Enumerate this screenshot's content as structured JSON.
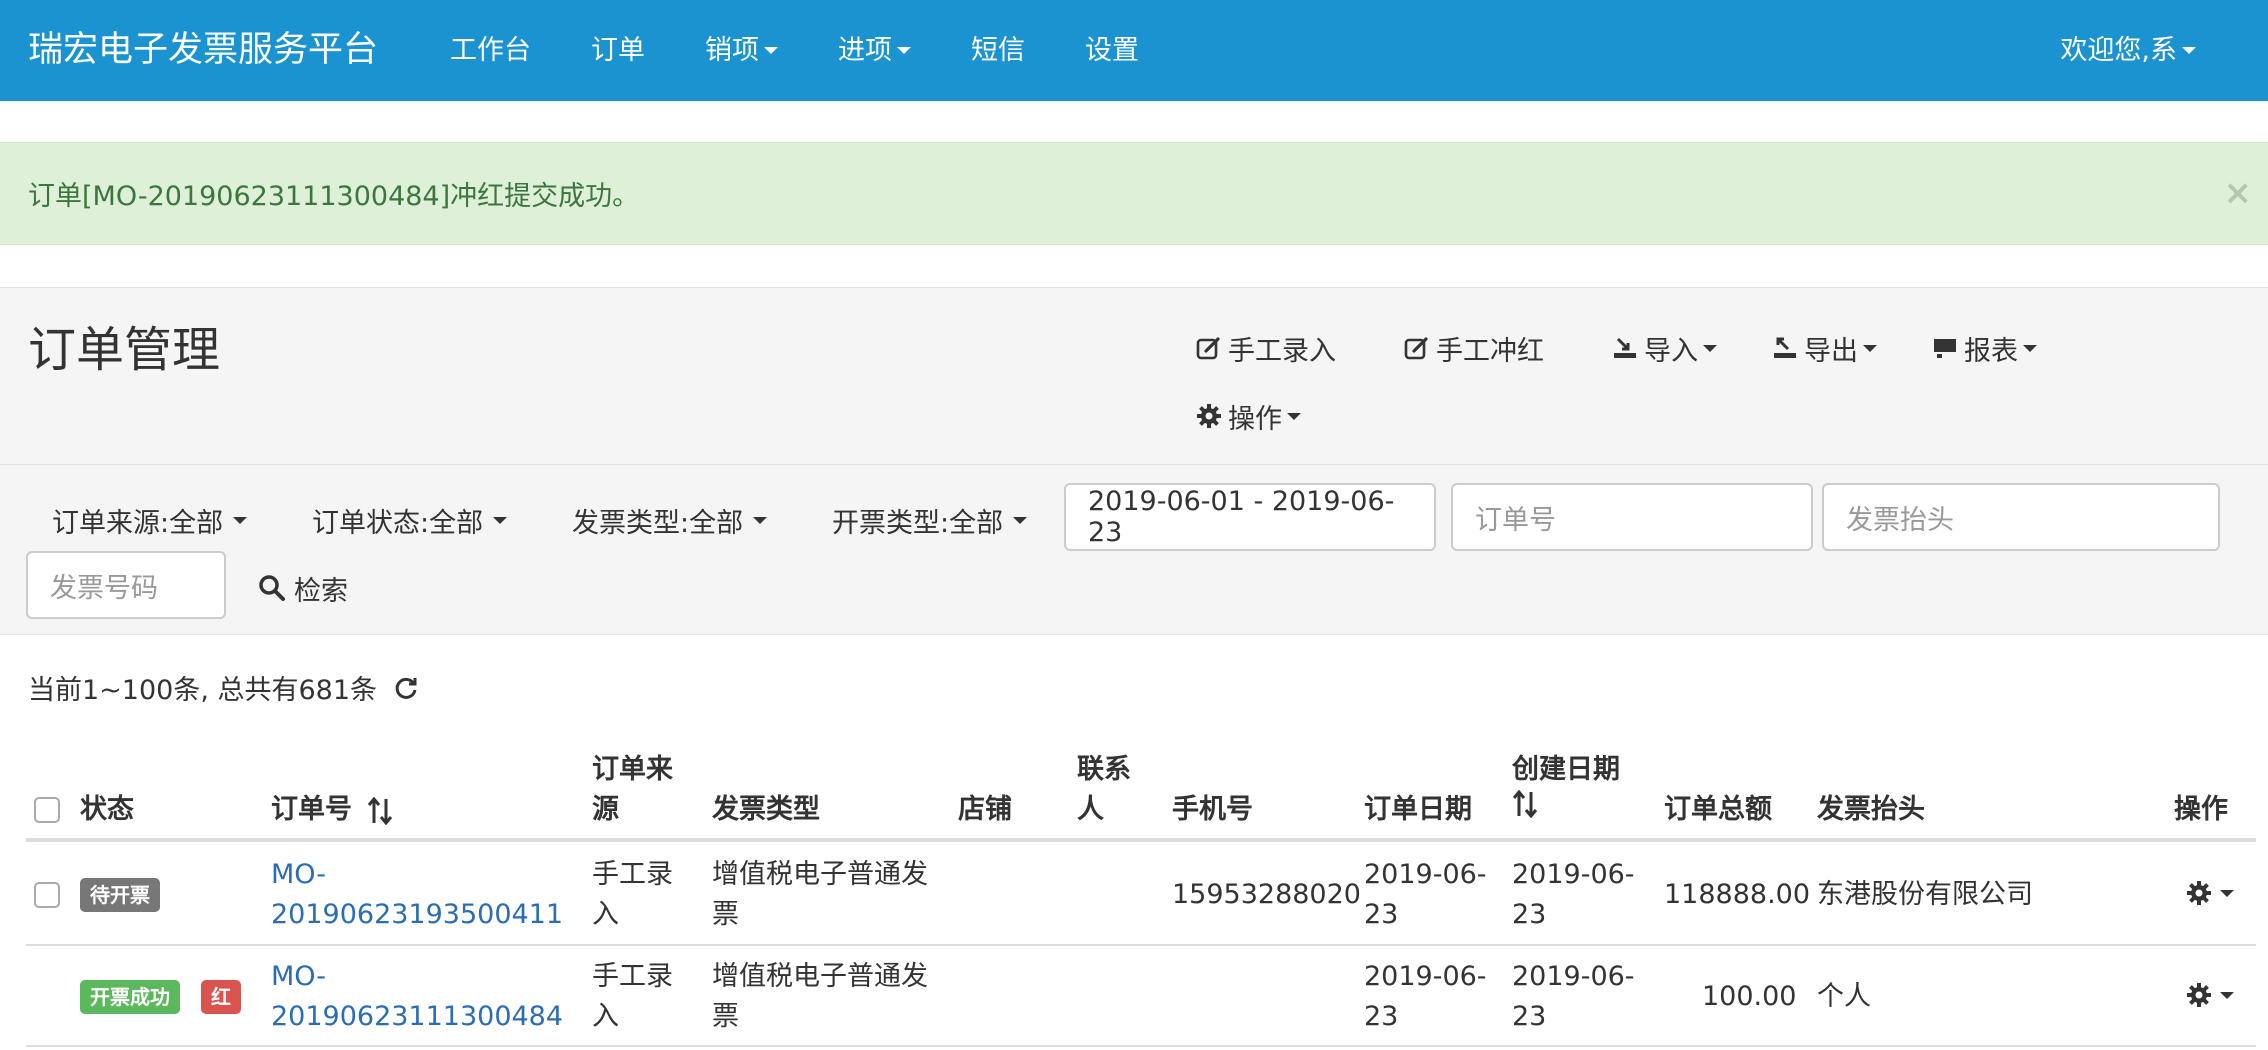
{
  "navbar": {
    "brand": "瑞宏电子发票服务平台",
    "items": [
      {
        "label": "工作台",
        "dropdown": false
      },
      {
        "label": "订单",
        "dropdown": false
      },
      {
        "label": "销项",
        "dropdown": true
      },
      {
        "label": "进项",
        "dropdown": true
      },
      {
        "label": "短信",
        "dropdown": false
      },
      {
        "label": "设置",
        "dropdown": false
      }
    ],
    "user": "欢迎您,系",
    "bg_color": "#1a93d0"
  },
  "alert": {
    "message": "订单[MO-20190623111300484]冲红提交成功。",
    "close": "×",
    "bg_color": "#dff0d8"
  },
  "page": {
    "title": "订单管理",
    "toolbar": {
      "manual_entry": "手工录入",
      "manual_red": "手工冲红",
      "import": "导入",
      "export": "导出",
      "report": "报表",
      "operate": "操作"
    }
  },
  "filters": {
    "order_source": "订单来源:全部",
    "order_status": "订单状态:全部",
    "invoice_type": "发票类型:全部",
    "issue_type": "开票类型:全部",
    "date_range": "2019-06-01 - 2019-06-23",
    "order_no_placeholder": "订单号",
    "invoice_title_placeholder": "发票抬头",
    "invoice_no_placeholder": "发票号码",
    "search_label": "检索"
  },
  "summary": {
    "text": "当前1~100条, 总共有681条"
  },
  "table": {
    "headers": {
      "status": "状态",
      "order_no": "订单号",
      "source_l1": "订单来",
      "source_l2": "源",
      "invoice_type": "发票类型",
      "shop": "店铺",
      "contact_l1": "联系",
      "contact_l2": "人",
      "phone": "手机号",
      "order_date": "订单日期",
      "created_date": "创建日期",
      "total": "订单总额",
      "invoice_title": "发票抬头",
      "actions": "操作"
    },
    "rows": [
      {
        "status": "待开票",
        "extra_badge": "",
        "order_no_l1": "MO-",
        "order_no_l2": "20190623193500411",
        "source_l1": "手工录",
        "source_l2": "入",
        "invoice_type_l1": "增值税电子普通发",
        "invoice_type_l2": "票",
        "shop": "",
        "contact": "",
        "phone": "15953288020",
        "order_date_l1": "2019-06-",
        "order_date_l2": "23",
        "created_date_l1": "2019-06-",
        "created_date_l2": "23",
        "total": "118888.00",
        "invoice_title": "东港股份有限公司"
      },
      {
        "status": "开票成功",
        "extra_badge": "红",
        "order_no_l1": "MO-",
        "order_no_l2": "20190623111300484",
        "source_l1": "手工录",
        "source_l2": "入",
        "invoice_type_l1": "增值税电子普通发",
        "invoice_type_l2": "票",
        "shop": "",
        "contact": "",
        "phone": "",
        "order_date_l1": "2019-06-",
        "order_date_l2": "23",
        "created_date_l1": "2019-06-",
        "created_date_l2": "23",
        "total": "100.00",
        "invoice_title": "个人"
      }
    ]
  },
  "icons": {
    "edit": "edit-icon",
    "import": "import-icon",
    "export": "export-icon",
    "report": "report-icon",
    "gear": "gear-icon",
    "search": "search-icon",
    "refresh": "refresh-icon",
    "sort": "sort-icon"
  }
}
